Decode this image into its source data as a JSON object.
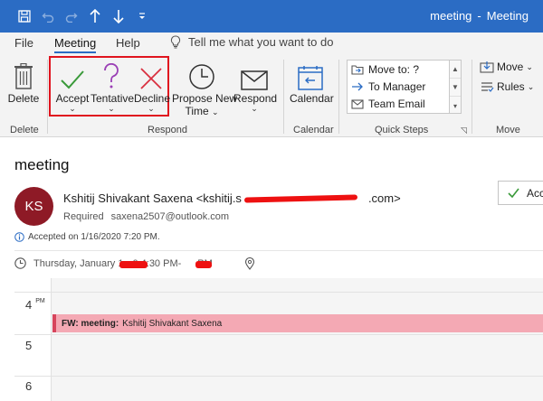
{
  "window": {
    "subject": "meeting",
    "app": "Meeting",
    "separator": "-"
  },
  "menu": {
    "tabs": [
      "File",
      "Meeting",
      "Help"
    ],
    "active_tab": "Meeting",
    "tell_me": "Tell me what you want to do"
  },
  "ribbon": {
    "delete": {
      "label": "Delete",
      "group": "Delete"
    },
    "respond": {
      "group": "Respond",
      "accept": "Accept",
      "tentative": "Tentative",
      "decline": "Decline",
      "propose_line1": "Propose New",
      "propose_line2": "Time",
      "respond": "Respond"
    },
    "calendar": {
      "label": "Calendar",
      "group": "Calendar"
    },
    "quick_steps": {
      "group": "Quick Steps",
      "items": [
        "Move to: ?",
        "To Manager",
        "Team Email"
      ]
    },
    "move": {
      "group": "Move",
      "move": "Move",
      "rules": "Rules"
    }
  },
  "message": {
    "subject": "meeting",
    "avatar_initials": "KS",
    "sender_name": "Kshitij Shivakant Saxena",
    "sender_email_start": "<kshitij.s",
    "sender_email_end": ".com>",
    "required_label": "Required",
    "required_email": "saxena2507@outlook.com",
    "accepted_on": "Accepted on 1/16/2020 7:20 PM.",
    "when_prefix": "Thursday, January 1",
    "when_mid": "0 4:30 PM-",
    "when_suffix": "PM",
    "reply_button": "Acc"
  },
  "calendar_preview": {
    "hours": [
      "4",
      "5",
      "6"
    ],
    "pm_marker": "PM",
    "event_prefix": "FW: meeting:",
    "event_organizer": "Kshitij Shivakant Saxena"
  },
  "colors": {
    "title_bar": "#2b6cc4",
    "accept_icon": "#3a9a3a",
    "tentative_icon": "#9a3fb5",
    "decline_icon": "#d93040",
    "highlight_box": "#e0141e",
    "avatar": "#8e1a26",
    "event": "#f4a9b4"
  }
}
